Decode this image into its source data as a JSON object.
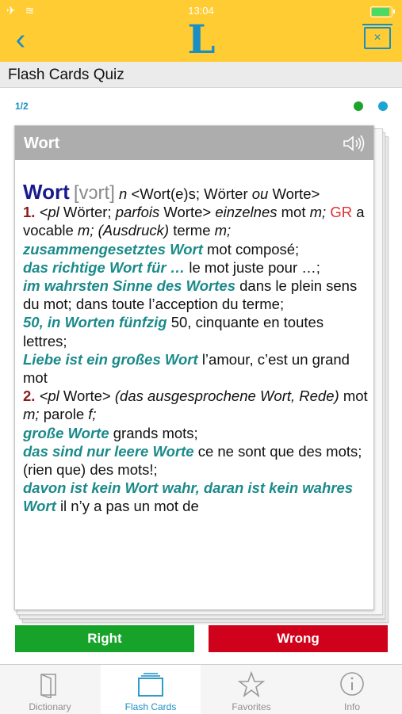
{
  "status": {
    "time": "13:04",
    "signal": "✈ ≋",
    "battery_color": "#4CD964"
  },
  "nav": {
    "back_glyph": "‹",
    "logo_letter": "L",
    "delete_glyph": "×",
    "accent": "#1A8FC4",
    "bar_color": "#FFCC33"
  },
  "screen": {
    "title": "Flash Cards Quiz"
  },
  "quiz": {
    "progress": "1/2"
  },
  "card": {
    "header_title": "Wort",
    "headword": "Wort",
    "pronunciation": "[vɔrt]",
    "entry": {
      "gram": "n",
      "forms_a": "<Wort(e)s; Wörter",
      "forms_ou": "ou",
      "forms_b": "Worte>",
      "n1": "1.",
      "s1_a": "<pl",
      "s1_b": "Wörter;",
      "s1_c": "parfois",
      "s1_d": "Worte>",
      "s1_e": "einzelnes",
      "s1_f": "mot",
      "s1_g": "m;",
      "s1_gr": "GR",
      "s1_h": "a vocable",
      "s1_i": "m;",
      "s1_j": "(Ausdruck)",
      "s1_k": "terme",
      "s1_l": "m;",
      "ex1": "zusammengesetztes Wort",
      "tr1": "mot composé;",
      "ex2": "das richtige Wort für …",
      "tr2": "le mot juste pour …;",
      "ex3": "im wahrsten Sinne des Wortes",
      "tr3": "dans le plein sens du mot; dans toute l’acception du terme;",
      "ex4": "50, in Worten fünfzig",
      "tr4": "50, cinquante en toutes lettres;",
      "ex5": "Liebe ist ein großes Wort",
      "tr5": "l’amour, c’est un grand mot",
      "n2": "2.",
      "s2_a": "<pl",
      "s2_b": "Worte>",
      "s2_c": "(das ausgesprochene Wort, Rede)",
      "s2_d": "mot",
      "s2_e": "m;",
      "s2_f": "parole",
      "s2_g": "f;",
      "ex6": "große Worte",
      "tr6": "grands mots;",
      "ex7": "das sind nur leere Worte",
      "tr7": "ce ne sont que des mots; (rien que) des mots!;",
      "ex8": "davon ist kein Wort wahr, daran ist kein wahres Wort",
      "tr8": "il n’y a pas un mot de"
    }
  },
  "buttons": {
    "right": "Right",
    "wrong": "Wrong",
    "right_color": "#17A32A",
    "wrong_color": "#D0021B"
  },
  "tabs": [
    {
      "label": "Dictionary",
      "icon": "book-icon"
    },
    {
      "label": "Flash Cards",
      "icon": "flashcards-icon"
    },
    {
      "label": "Favorites",
      "icon": "star-icon"
    },
    {
      "label": "Info",
      "icon": "info-icon"
    }
  ]
}
